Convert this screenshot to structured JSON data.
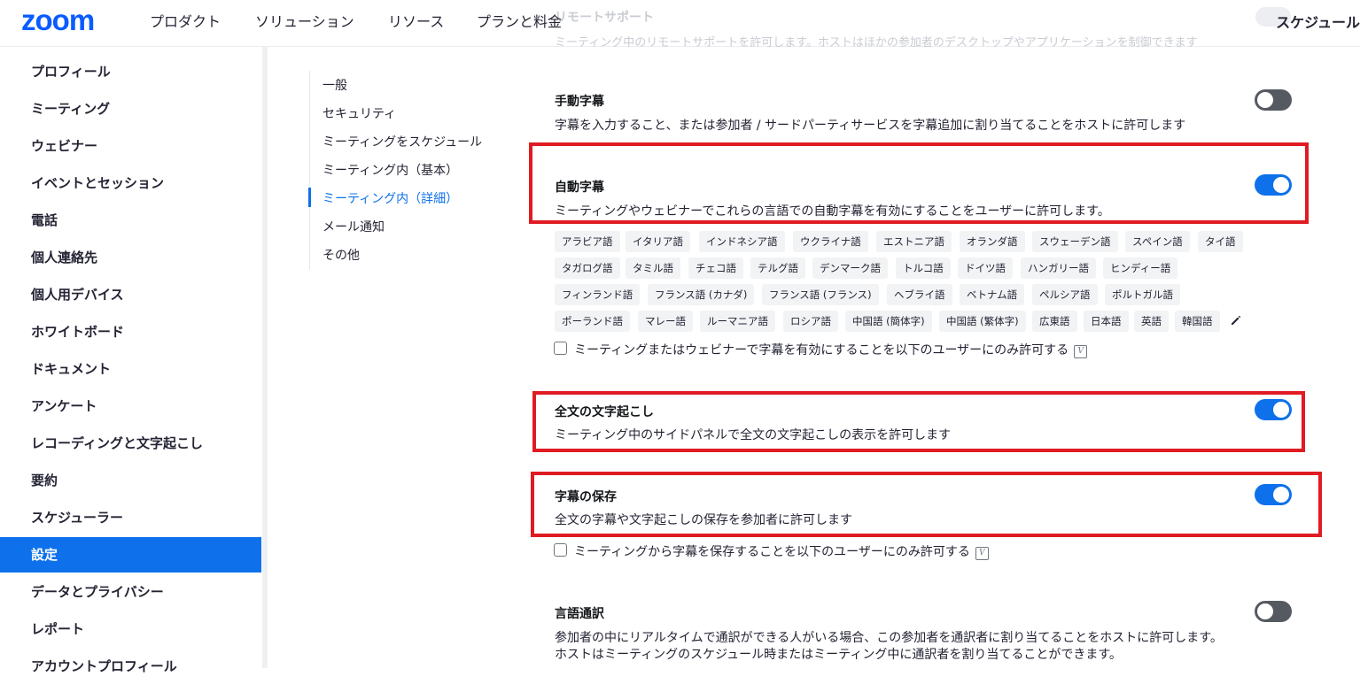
{
  "header": {
    "logo": "zoom",
    "nav": [
      "プロダクト",
      "ソリューション",
      "リソース",
      "プランと料金"
    ],
    "schedule_link": "スケジュール",
    "faded_title": "リモートサポート",
    "faded_desc": "ミーティング中のリモートサポートを許可します。ホストはほかの参加者のデスクトップやアプリケーションを制御できます"
  },
  "sidebar": {
    "items": [
      "プロフィール",
      "ミーティング",
      "ウェビナー",
      "イベントとセッション",
      "電話",
      "個人連絡先",
      "個人用デバイス",
      "ホワイトボード",
      "ドキュメント",
      "アンケート",
      "レコーディングと文字起こし",
      "要約",
      "スケジューラー",
      "設定",
      "データとプライバシー",
      "レポート",
      "アカウントプロフィール"
    ],
    "active": "設定"
  },
  "subnav": {
    "items": [
      "一般",
      "セキュリティ",
      "ミーティングをスケジュール",
      "ミーティング内（基本）",
      "ミーティング内（詳細）",
      "メール通知",
      "その他"
    ],
    "active": "ミーティング内（詳細）"
  },
  "settings": {
    "manual_captions": {
      "title": "手動字幕",
      "desc": "字幕を入力すること、または参加者 / サードパーティサービスを字幕追加に割り当てることをホストに許可します",
      "enabled": false
    },
    "auto_captions": {
      "title": "自動字幕",
      "desc": "ミーティングやウェビナーでこれらの言語での自動字幕を有効にすることをユーザーに許可します。",
      "enabled": true,
      "languages": [
        [
          "アラビア語",
          "イタリア語",
          "インドネシア語",
          "ウクライナ語",
          "エストニア語",
          "オランダ語",
          "スウェーデン語",
          "スペイン語",
          "タイ語"
        ],
        [
          "タガログ語",
          "タミル語",
          "チェコ語",
          "テルグ語",
          "デンマーク語",
          "トルコ語",
          "ドイツ語",
          "ハンガリー語",
          "ヒンディー語"
        ],
        [
          "フィンランド語",
          "フランス語 (カナダ)",
          "フランス語 (フランス)",
          "ヘブライ語",
          "ベトナム語",
          "ペルシア語",
          "ポルトガル語"
        ],
        [
          "ポーランド語",
          "マレー語",
          "ルーマニア語",
          "ロシア語",
          "中国語 (簡体字)",
          "中国語 (繁体字)",
          "広東語",
          "日本語",
          "英語",
          "韓国語"
        ]
      ],
      "restrict_label": "ミーティングまたはウェビナーで字幕を有効にすることを以下のユーザーにのみ許可する",
      "restrict_checked": false
    },
    "full_transcript": {
      "title": "全文の文字起こし",
      "desc": "ミーティング中のサイドパネルで全文の文字起こしの表示を許可します",
      "enabled": true
    },
    "save_captions": {
      "title": "字幕の保存",
      "desc": "全文の字幕や文字起こしの保存を参加者に許可します",
      "enabled": true,
      "restrict_label": "ミーティングから字幕を保存することを以下のユーザーにのみ許可する",
      "restrict_checked": false
    },
    "interpretation": {
      "title": "言語通訳",
      "desc1": "参加者の中にリアルタイムで通訳ができる人がいる場合、この参加者を通訳者に割り当てることをホストに許可します。",
      "desc2": "ホストはミーティングのスケジュール時またはミーティング中に通訳者を割り当てることができます。",
      "enabled": false
    },
    "v_icon": "V"
  },
  "colors": {
    "accent": "#0e71eb",
    "highlight": "#e01b22",
    "toggle_off": "#555a61"
  }
}
